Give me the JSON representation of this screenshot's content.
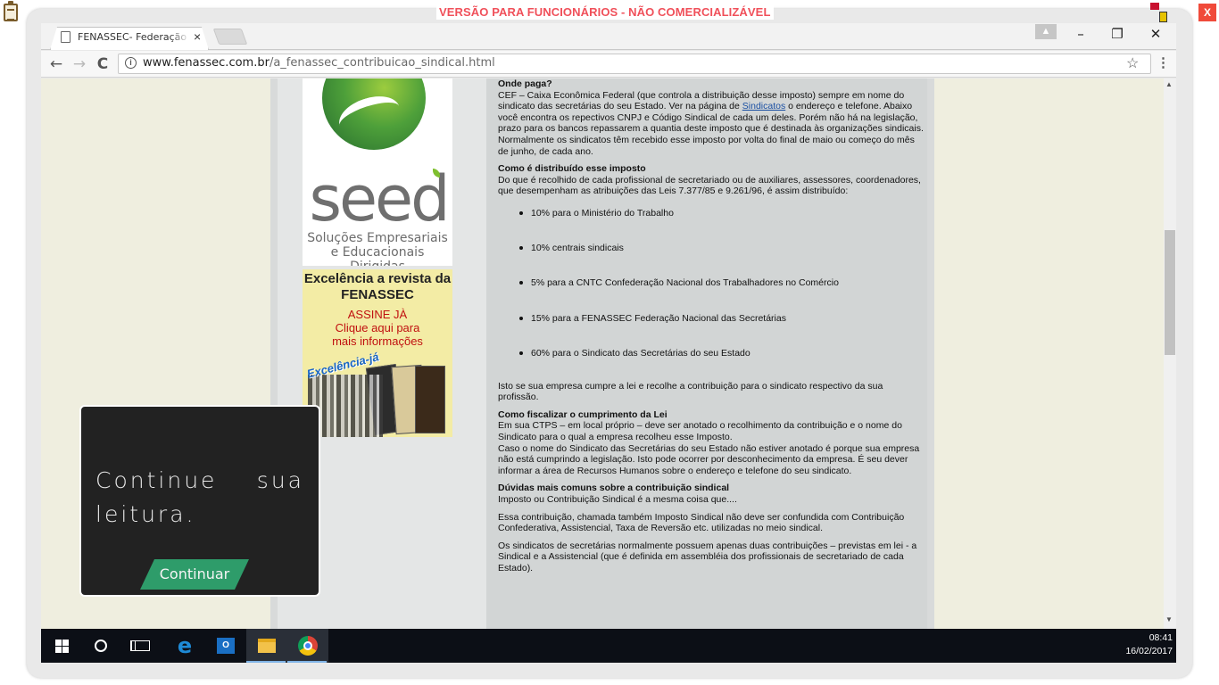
{
  "overlay_banner": {
    "text": "VERSÃO PARA FUNCIONÁRIOS - NÃO COMERCIALIZÁVEL",
    "close_label": "X"
  },
  "browser": {
    "tab_title": "FENASSEC- Federação Nacional",
    "tab_close": "×",
    "window_controls": {
      "minimize": "–",
      "restore": "❐",
      "close": "✕"
    },
    "nav": {
      "back": "←",
      "forward": "→",
      "reload": "C"
    },
    "url_host": "www.fenassec.com.br",
    "url_path": "/a_fenassec_contribuicao_sindical.html",
    "icons": [
      "info-icon",
      "star-icon",
      "menu-icon"
    ]
  },
  "sidebar": {
    "seed_ad": {
      "logo_word": "seed",
      "tagline": "Soluções Empresariais e Educacionais Dirigidas"
    },
    "magazine_ad": {
      "title": "Excelência a revista da FENASSEC",
      "cta_1": "ASSINE JÀ",
      "cta_2": "Clique aqui para mais informações",
      "cover_logo": "Excelência-já"
    }
  },
  "article": {
    "where_heading": "Onde paga?",
    "where_text_1": "CEF – Caixa Econômica Federal (que controla a distribuição desse imposto) sempre em nome do sindicato das secretárias do seu Estado. Ver na página de ",
    "where_link": "Sindicatos",
    "where_text_2": " o endereço e telefone. Abaixo você encontra os repectivos CNPJ e Código Sindical de cada um deles. Porém não há na legislação, prazo para os bancos repassarem a quantia deste imposto que é destinada às organizações sindicais. Normalmente os sindicatos têm recebido esse imposto por volta do final de maio ou começo do mês de junho, de cada ano.",
    "distrib_heading": "Como é distribuído esse imposto",
    "distrib_text": "Do que é recolhido de cada profissional de secretariado ou de auxiliares, assessores, coordenadores, que desempenham as atribuições das Leis 7.377/85 e 9.261/96, é assim distribuído:",
    "distrib_items": [
      "10% para o Ministério do Trabalho",
      "10% centrais sindicais",
      "5% para a CNTC Confederação Nacional dos Trabalhadores no Comércio",
      "15% para a FENASSEC Federação Nacional das Secretárias",
      "60% para o Sindicato das Secretárias do seu Estado"
    ],
    "distrib_footer": "Isto se sua empresa cumpre a lei e recolhe a contribuição para o sindicato respectivo da sua profissão.",
    "check_heading": "Como fiscalizar o cumprimento da Lei",
    "check_text_1": "Em sua CTPS – em local próprio – deve ser anotado o recolhimento da contribuição e o nome do Sindicato para o qual a empresa recolheu esse Imposto.",
    "check_text_2": "Caso o nome do Sindicato das Secretárias do seu Estado não estiver anotado é porque sua empresa não está cumprindo a legislação. Isto pode ocorrer por desconhecimento da empresa. É seu dever informar a área de Recursos Humanos sobre o endereço e telefone do seu sindicato.",
    "faq_heading": "Dúvidas mais comuns sobre a contribuição sindical",
    "faq_q1": "Imposto ou Contribuição Sindical é a mesma coisa que....",
    "faq_a1": "Essa contribuição, chamada também Imposto Sindical não deve ser confundida com Contribuição Confederativa, Assistencial, Taxa de Reversão etc. utilizadas no meio sindical.",
    "faq_a2": "Os sindicatos de secretárias normalmente possuem apenas duas contribuições – previstas em lei - a Sindical e a Assistencial (que é definida em assembléia dos profissionais de secretariado de cada Estado)."
  },
  "popup": {
    "text": "Continue sua leitura.",
    "button": "Continuar"
  },
  "taskbar": {
    "apps": [
      "windows-start",
      "cortana",
      "task-view",
      "edge",
      "outlook",
      "file-explorer",
      "chrome"
    ],
    "time": "08:41",
    "date": "16/02/2017"
  },
  "colors": {
    "banner_red": "#f0505a",
    "popup_bg": "#222222",
    "popup_button": "#2e9c6a",
    "link": "#1a4fa3",
    "taskbar": "#0c0f16"
  }
}
